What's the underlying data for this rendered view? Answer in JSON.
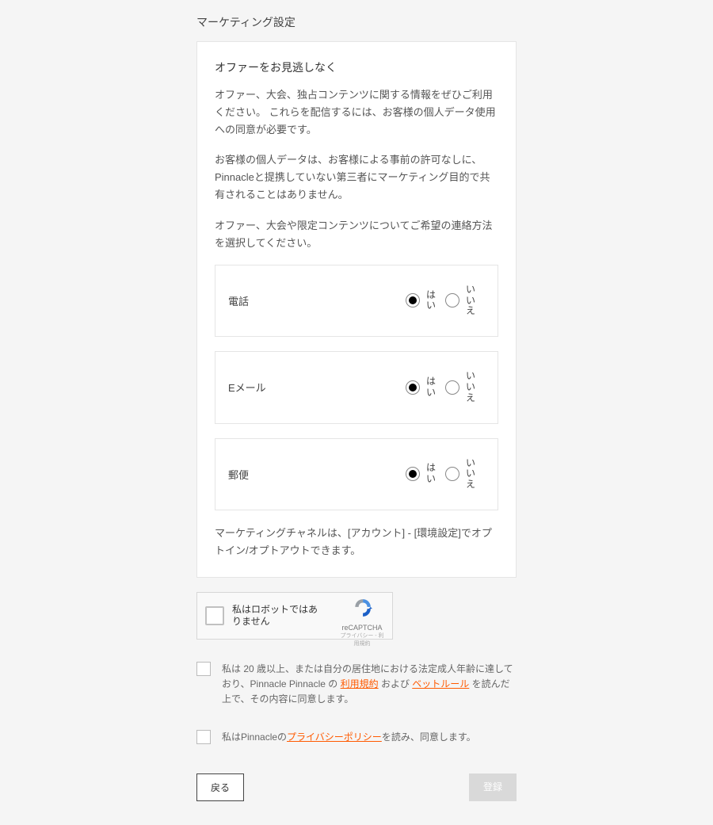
{
  "page": {
    "title": "マーケティング設定"
  },
  "card": {
    "title": "オファーをお見逃しなく",
    "p1": "オファー、大会、独占コンテンツに関する情報をぜひご利用ください。 これらを配信するには、お客様の個人データ使用への同意が必要です。",
    "p2": "お客様の個人データは、お客様による事前の許可なしに、Pinnacleと提携していない第三者にマーケティング目的で共有されることはありません。",
    "p3": "オファー、大会や限定コンテンツについてご希望の連絡方法を選択してください。",
    "footnote": "マーケティングチャネルは、[アカウント] - [環境設定]でオプトイン/オプトアウトできます。"
  },
  "radio": {
    "yes": "はい",
    "no": "いいえ"
  },
  "prefs": {
    "items": [
      {
        "label": "電話",
        "selected": "yes"
      },
      {
        "label": "Eメール",
        "selected": "yes"
      },
      {
        "label": "郵便",
        "selected": "yes"
      }
    ]
  },
  "recaptcha": {
    "text": "私はロボットではありません",
    "brand": "reCAPTCHA",
    "links": "プライバシー - 利用規約"
  },
  "consent1": {
    "pre": "私は 20 歳以上、または自分の居住地における法定成人年齢に達しており、Pinnacle Pinnacle の ",
    "link1": "利用規約",
    "mid": " および ",
    "link2": "ベットルール",
    "post": " を読んだ上で、その内容に同意します。"
  },
  "consent2": {
    "pre": "私はPinnacleの",
    "link": "プライバシーポリシー",
    "post": "を読み、同意します。"
  },
  "buttons": {
    "back": "戻る",
    "submit": "登録"
  }
}
